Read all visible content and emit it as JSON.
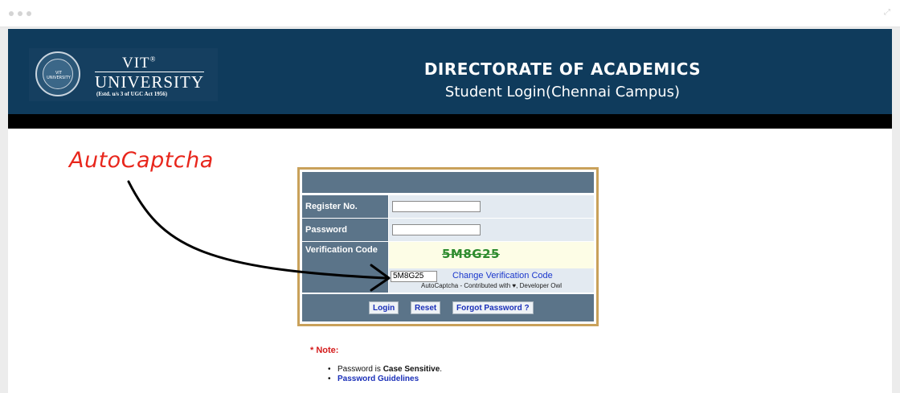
{
  "browser": {
    "expand_glyph": "⤢"
  },
  "header": {
    "logo": {
      "vit": "VIT",
      "reg": "®",
      "university": "UNIVERSITY",
      "estd": "(Estd. u/s 3 of UGC Act 1956)",
      "seal_text": "VIT UNIVERSITY"
    },
    "title": "DIRECTORATE OF ACADEMICS",
    "subtitle": "Student Login(Chennai Campus)"
  },
  "annotation": {
    "label": "AutoCaptcha",
    "color": "#e8261c"
  },
  "form": {
    "register_label": "Register No.",
    "register_value": "",
    "password_label": "Password",
    "password_value": "",
    "verification_label": "Verification Code",
    "captcha_image_text": "5M8G25",
    "captcha_input_value": "5M8G25",
    "change_code_link": "Change Verification Code",
    "contribution": "AutoCaptcha - Contributed with ♥, Developer Owl",
    "buttons": {
      "login": "Login",
      "reset": "Reset",
      "forgot": "Forgot Password ?"
    }
  },
  "note": {
    "title": "* Note:",
    "item1_prefix": "Password is ",
    "item1_bold": "Case Sensitive",
    "item1_suffix": ".",
    "item2_link": "Password Guidelines"
  },
  "colors": {
    "banner": "#0f3b5c",
    "panel": "#5b7489",
    "border": "#c9a15a",
    "link": "#1a37cc"
  }
}
